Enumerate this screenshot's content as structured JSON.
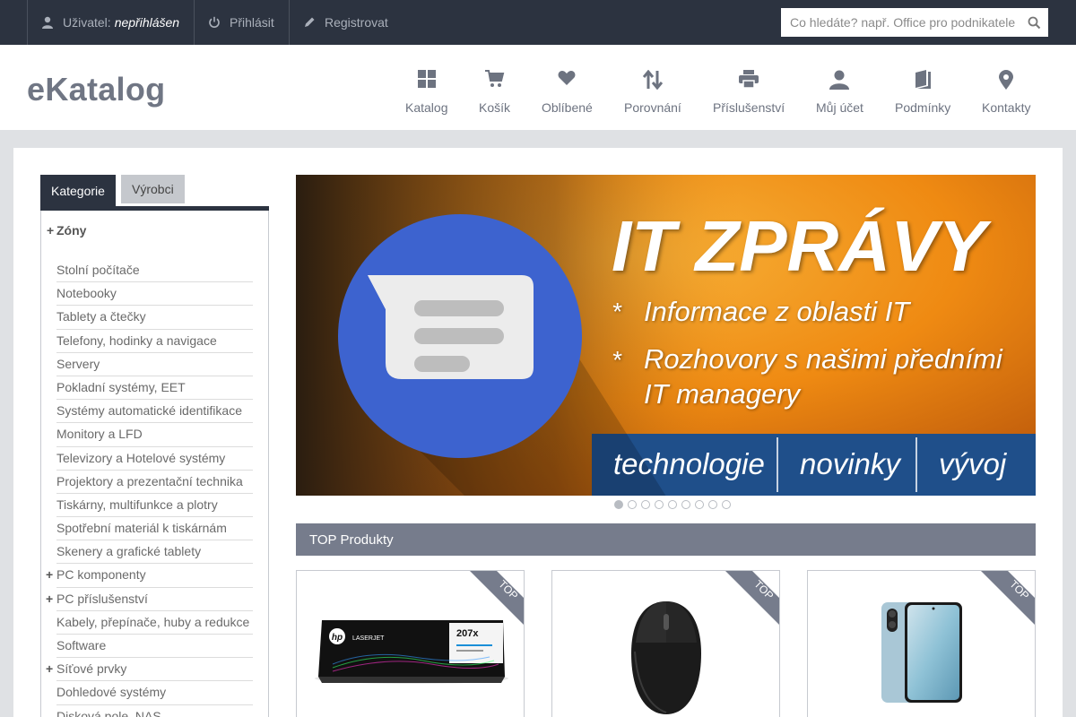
{
  "topbar": {
    "user_label": "Uživatel:",
    "user_name": "nepřihlášen",
    "login": "Přihlásit",
    "register": "Registrovat",
    "search_placeholder": "Co hledáte? např. Office pro podnikatele"
  },
  "header": {
    "logo": "eKatalog",
    "nav": [
      {
        "label": "Katalog",
        "icon": "grid-icon"
      },
      {
        "label": "Košík",
        "icon": "cart-icon"
      },
      {
        "label": "Oblíbené",
        "icon": "heart-icon"
      },
      {
        "label": "Porovnání",
        "icon": "compare-arrows-icon"
      },
      {
        "label": "Příslušenství",
        "icon": "printer-icon"
      },
      {
        "label": "Můj účet",
        "icon": "user-icon"
      },
      {
        "label": "Podmínky",
        "icon": "book-icon"
      },
      {
        "label": "Kontakty",
        "icon": "map-pin-icon"
      }
    ]
  },
  "sidebar": {
    "tabs": [
      "Kategorie",
      "Výrobci"
    ],
    "zone": "Zóny",
    "categories": [
      {
        "label": "Stolní počítače",
        "expandable": false
      },
      {
        "label": "Notebooky",
        "expandable": false
      },
      {
        "label": "Tablety a čtečky",
        "expandable": false
      },
      {
        "label": "Telefony, hodinky a navigace",
        "expandable": false
      },
      {
        "label": "Servery",
        "expandable": false
      },
      {
        "label": "Pokladní systémy, EET",
        "expandable": false
      },
      {
        "label": "Systémy automatické identifikace",
        "expandable": false
      },
      {
        "label": "Monitory a LFD",
        "expandable": false
      },
      {
        "label": "Televizory a Hotelové systémy",
        "expandable": false
      },
      {
        "label": "Projektory a prezentační technika",
        "expandable": false
      },
      {
        "label": "Tiskárny, multifunkce a plotry",
        "expandable": false
      },
      {
        "label": "Spotřební materiál k tiskárnám",
        "expandable": false
      },
      {
        "label": "Skenery a grafické tablety",
        "expandable": false
      },
      {
        "label": "PC komponenty",
        "expandable": true
      },
      {
        "label": "PC příslušenství",
        "expandable": true
      },
      {
        "label": "Kabely, přepínače, huby a redukce",
        "expandable": false
      },
      {
        "label": "Software",
        "expandable": false
      },
      {
        "label": "Síťové prvky",
        "expandable": true
      },
      {
        "label": "Dohledové systémy",
        "expandable": false
      },
      {
        "label": "Disková pole, NAS",
        "expandable": false
      }
    ]
  },
  "banner": {
    "title": "IT ZPRÁVY",
    "bullet1": "Informace z oblasti IT",
    "bullet2a": "Rozhovory s našimi předními",
    "bullet2b": "IT managery",
    "bullet_mark": "*",
    "footer": [
      "technologie",
      "novinky",
      "vývoj"
    ],
    "slides": 9,
    "active_slide": 1
  },
  "top_products": {
    "heading": "TOP Produkty",
    "badge": "TOP",
    "box_texts": [
      "LASERJET",
      "207x"
    ],
    "items": [
      {
        "image": "hp-toner-box-image"
      },
      {
        "image": "wireless-mouse-image"
      },
      {
        "image": "smartphone-image"
      }
    ]
  },
  "colors": {
    "dark": "#2c3340",
    "accent_orange": "#f39a1a",
    "banner_blue": "#1f4f8a",
    "badge_gray": "#767c8c"
  }
}
